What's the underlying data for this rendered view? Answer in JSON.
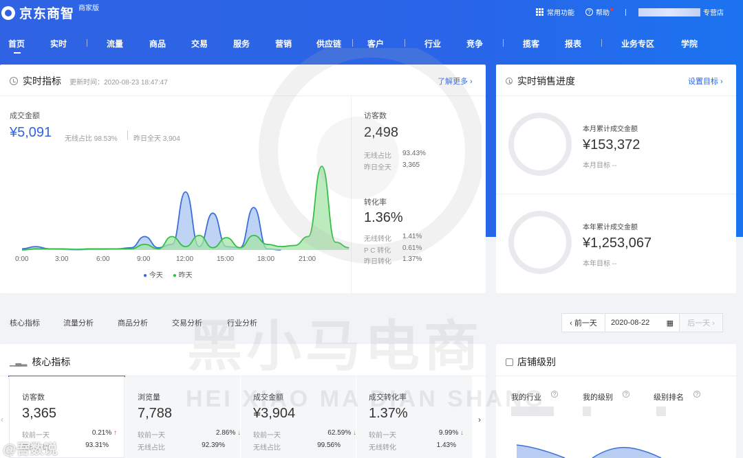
{
  "header": {
    "brand": "京东商智",
    "edition": "商家版",
    "common": "常用功能",
    "help": "帮助",
    "shop": "专营店"
  },
  "nav": [
    "首页",
    "实时",
    "流量",
    "商品",
    "交易",
    "服务",
    "营销",
    "供应链",
    "客户",
    "行业",
    "竞争",
    "揽客",
    "报表",
    "业务专区",
    "学院"
  ],
  "realtime": {
    "title": "实时指标",
    "updated": "更新时间：2020-08-23 18:47:47",
    "more": "了解更多 ›",
    "gmv_label": "成交金额",
    "gmv": "¥5,091",
    "wireless": "无线占比 98.53%",
    "yday": "昨日全天 3,904",
    "visitors_label": "访客数",
    "visitors": "2,498",
    "v_wireless_l": "无线占比",
    "v_wireless": "93.43%",
    "v_yday_l": "昨日全天",
    "v_yday": "3,365",
    "conv_label": "转化率",
    "conv": "1.36%",
    "c1_l": "无线转化",
    "c1": "1.41%",
    "c2_l": "P C 转化",
    "c2": "0.61%",
    "c3_l": "昨日转化",
    "c3": "1.37%",
    "legend_today": "今天",
    "legend_yday": "昨天"
  },
  "chart_data": {
    "type": "area",
    "x": [
      "0:00",
      "3:00",
      "6:00",
      "9:00",
      "12:00",
      "15:00",
      "18:00",
      "21:00"
    ],
    "xlim": [
      0,
      24
    ],
    "series": [
      {
        "name": "今天",
        "color": "#3a6fd8",
        "fill": "#a9c6f2",
        "points": [
          [
            0,
            1
          ],
          [
            1,
            3
          ],
          [
            2,
            1
          ],
          [
            3,
            0.5
          ],
          [
            4,
            0.3
          ],
          [
            5,
            0.5
          ],
          [
            6,
            0.5
          ],
          [
            7,
            1
          ],
          [
            8,
            2
          ],
          [
            9,
            12
          ],
          [
            10,
            2
          ],
          [
            11,
            5
          ],
          [
            12,
            52
          ],
          [
            13,
            3
          ],
          [
            14,
            33
          ],
          [
            15,
            3
          ],
          [
            16,
            2
          ],
          [
            17,
            38
          ],
          [
            18,
            1
          ],
          [
            19,
            0
          ]
        ]
      },
      {
        "name": "昨天",
        "color": "#33c045",
        "fill": "#a6e4a8",
        "points": [
          [
            0,
            0
          ],
          [
            1,
            1
          ],
          [
            2,
            1
          ],
          [
            3,
            1
          ],
          [
            4,
            0.5
          ],
          [
            5,
            1
          ],
          [
            6,
            1
          ],
          [
            7,
            1
          ],
          [
            8,
            1
          ],
          [
            9,
            5
          ],
          [
            10,
            1
          ],
          [
            11,
            12
          ],
          [
            12,
            3
          ],
          [
            13,
            13
          ],
          [
            14,
            2
          ],
          [
            15,
            11
          ],
          [
            16,
            2
          ],
          [
            17,
            13
          ],
          [
            18,
            5
          ],
          [
            19,
            3
          ],
          [
            20,
            4
          ],
          [
            21,
            12
          ],
          [
            22,
            75
          ],
          [
            23,
            7
          ],
          [
            24,
            2
          ]
        ]
      }
    ]
  },
  "sales": {
    "title": "实时销售进度",
    "set": "设置目标 ›",
    "month_l": "本月累计成交金额",
    "month": "¥153,372",
    "month_t": "本月目标 --",
    "year_l": "本年累计成交金额",
    "year": "¥1,253,067",
    "year_t": "本年目标 --"
  },
  "tabs": [
    "核心指标",
    "流量分析",
    "商品分析",
    "交易分析",
    "行业分析"
  ],
  "date": {
    "prev": "‹ 前一天",
    "value": "2020-08-22",
    "next": "后一天 ›"
  },
  "core": {
    "title": "核心指标"
  },
  "kpis": [
    {
      "label": "访客数",
      "value": "3,365",
      "r1l": "较前一天",
      "r1": "0.21%",
      "r1d": "↑",
      "r2l": "无线占比",
      "r2": "93.31%"
    },
    {
      "label": "浏览量",
      "value": "7,788",
      "r1l": "较前一天",
      "r1": "2.86%",
      "r1d": "↓",
      "r2l": "无线占比",
      "r2": "92.39%"
    },
    {
      "label": "成交金额",
      "value": "¥3,904",
      "r1l": "较前一天",
      "r1": "62.59%",
      "r1d": "↓",
      "r2l": "无线占比",
      "r2": "99.56%"
    },
    {
      "label": "成交转化率",
      "value": "1.37%",
      "r1l": "较前一天",
      "r1": "9.99%",
      "r1d": "↓",
      "r2l": "无线转化",
      "r2": "1.43%"
    }
  ],
  "level": {
    "title": "店铺级别",
    "industry": "我的行业",
    "mylevel": "我的级别",
    "rank": "级别排名"
  },
  "watermark": {
    "cn": "黑小马电商",
    "en": "HEI XIAO MA DIAN SHANG",
    "corner": "@吾数说"
  }
}
